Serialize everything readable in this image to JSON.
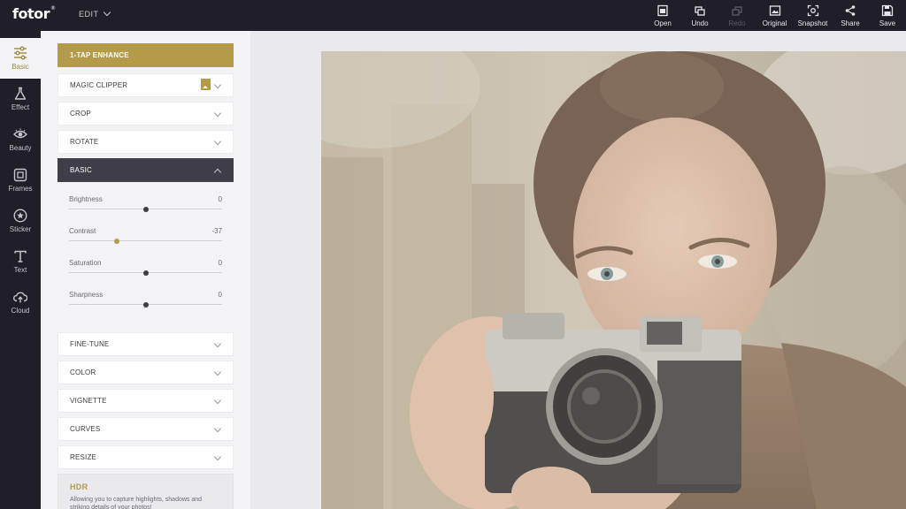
{
  "app": {
    "logo": "fotor",
    "logo_mark": "®",
    "menu_label": "EDIT"
  },
  "toolbar": [
    {
      "label": "Open",
      "icon": "open-icon",
      "enabled": true
    },
    {
      "label": "Undo",
      "icon": "undo-icon",
      "enabled": true
    },
    {
      "label": "Redo",
      "icon": "redo-icon",
      "enabled": false
    },
    {
      "label": "Original",
      "icon": "original-icon",
      "enabled": true
    },
    {
      "label": "Snapshot",
      "icon": "snapshot-icon",
      "enabled": true
    },
    {
      "label": "Share",
      "icon": "share-icon",
      "enabled": true
    },
    {
      "label": "Save",
      "icon": "save-icon",
      "enabled": true
    }
  ],
  "sidebar": [
    {
      "label": "Basic",
      "icon": "sliders-icon",
      "active": true
    },
    {
      "label": "Effect",
      "icon": "flask-icon",
      "active": false
    },
    {
      "label": "Beauty",
      "icon": "eye-icon",
      "active": false
    },
    {
      "label": "Frames",
      "icon": "frame-icon",
      "active": false
    },
    {
      "label": "Sticker",
      "icon": "star-icon",
      "active": false
    },
    {
      "label": "Text",
      "icon": "text-icon",
      "active": false
    },
    {
      "label": "Cloud",
      "icon": "cloud-upload-icon",
      "active": false
    }
  ],
  "panel": {
    "enhance": "1-TAP ENHANCE",
    "sections_top": [
      "MAGIC CLIPPER",
      "CROP",
      "ROTATE"
    ],
    "basic": "BASIC",
    "sliders": [
      {
        "label": "Brightness",
        "value": "0",
        "position": 0.5
      },
      {
        "label": "Contrast",
        "value": "-37",
        "position": 0.315
      },
      {
        "label": "Saturation",
        "value": "0",
        "position": 0.5
      },
      {
        "label": "Sharpness",
        "value": "0",
        "position": 0.5
      }
    ],
    "sections_bottom": [
      "FINE-TUNE",
      "COLOR",
      "VIGNETTE",
      "CURVES",
      "RESIZE"
    ],
    "hdr": {
      "title": "HDR",
      "description": "Allowing you to capture highlights, shadows and striking details of your photos!"
    }
  },
  "colors": {
    "accent": "#b39b49",
    "dark": "#1f1e29",
    "panel": "#f3f3f5",
    "active_section": "#3e3d48"
  }
}
